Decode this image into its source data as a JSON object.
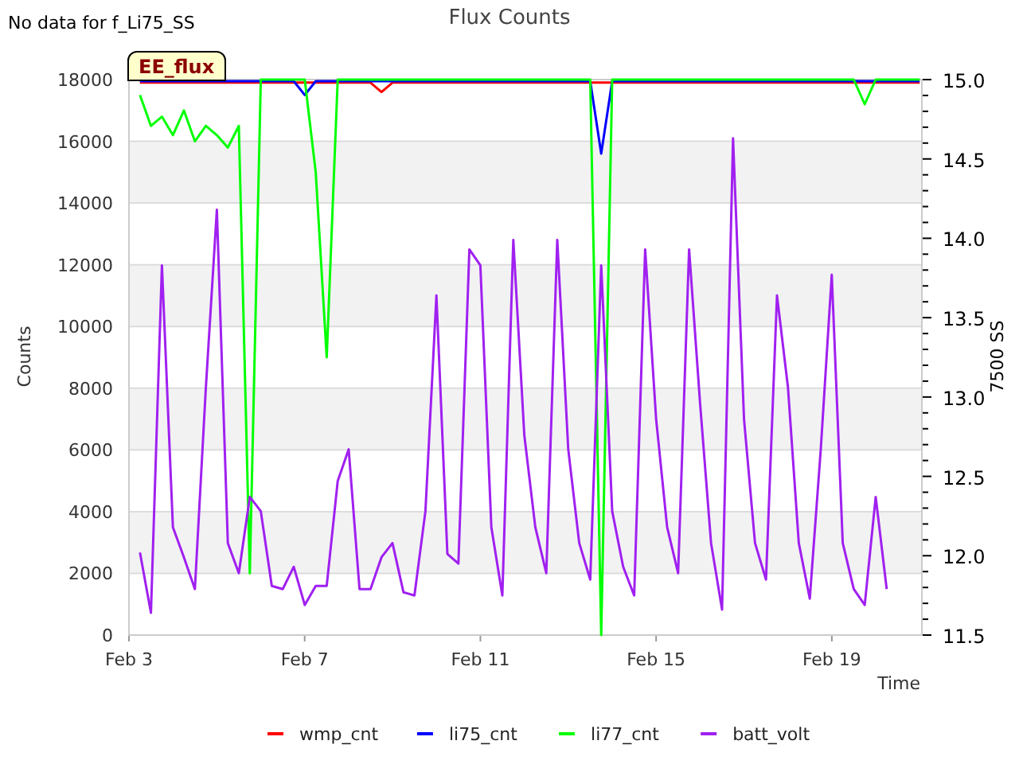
{
  "message": "No data for f_Li75_SS",
  "chart": {
    "badge": "EE_flux",
    "chart_data": {
      "type": "line",
      "title": "Flux Counts",
      "xlabel": "Time",
      "ylabel": "Counts",
      "y2label": "7500 SS",
      "ylim": [
        0,
        18000
      ],
      "grid": "y",
      "legend": "bottom",
      "y2lim": [
        11.5,
        15
      ],
      "yticks": [
        0,
        2000,
        4000,
        6000,
        8000,
        10000,
        12000,
        14000,
        16000,
        18000
      ],
      "y2ticks": [
        11.5,
        {
          "value": 12,
          "label": "12.0"
        },
        12.5,
        {
          "value": 13,
          "label": "13.0"
        },
        13.5,
        {
          "value": 14,
          "label": "14.0"
        },
        14.5,
        {
          "value": 15,
          "label": "15.0"
        }
      ],
      "categories": [
        "Feb 3",
        null,
        null,
        null,
        null,
        null,
        null,
        null,
        null,
        null,
        null,
        null,
        null,
        null,
        null,
        null,
        "Feb 7",
        null,
        null,
        null,
        null,
        null,
        null,
        null,
        null,
        null,
        null,
        null,
        null,
        null,
        null,
        null,
        "Feb 11",
        null,
        null,
        null,
        null,
        null,
        null,
        null,
        null,
        null,
        null,
        null,
        null,
        null,
        null,
        null,
        "Feb 15",
        null,
        null,
        null,
        null,
        null,
        null,
        null,
        null,
        null,
        null,
        null,
        null,
        null,
        null,
        null,
        "Feb 19",
        null,
        null,
        null,
        null,
        null,
        null,
        null,
        null
      ],
      "series": [
        {
          "name": "wmp_cnt",
          "color": "#ff0000",
          "values": [
            null,
            17900,
            17900,
            17900,
            17900,
            17900,
            17900,
            17900,
            17900,
            17900,
            17900,
            17900,
            17900,
            17900,
            17900,
            17900,
            17900,
            17900,
            17900,
            17900,
            17900,
            17900,
            17900,
            17600,
            17900,
            17900,
            17900,
            17900,
            17900,
            17900,
            17900,
            17900,
            17900,
            17900,
            17900,
            17900,
            17900,
            17900,
            17900,
            17900,
            17900,
            17900,
            17900,
            17900,
            17900,
            17900,
            17900,
            17900,
            17900,
            17900,
            17900,
            17900,
            17900,
            17900,
            17900,
            17900,
            17900,
            17900,
            17900,
            17900,
            17900,
            17900,
            17900,
            17900,
            17900,
            17900,
            17900,
            17900,
            17900,
            17900,
            17900,
            17900,
            17900
          ]
        },
        {
          "name": "li75_cnt",
          "color": "#0000ff",
          "values": [
            null,
            17950,
            17950,
            17950,
            17950,
            17950,
            17950,
            17950,
            17950,
            17950,
            17950,
            17950,
            17950,
            17950,
            17950,
            17950,
            17500,
            17950,
            17950,
            17950,
            17950,
            17950,
            17950,
            17950,
            17950,
            17950,
            17950,
            17950,
            17950,
            17950,
            17950,
            17950,
            17950,
            17950,
            17950,
            17950,
            17950,
            17950,
            17950,
            17950,
            17950,
            17950,
            17950,
            15600,
            17950,
            17950,
            17950,
            17950,
            17950,
            17950,
            17950,
            17950,
            17950,
            17950,
            17950,
            17950,
            17950,
            17950,
            17950,
            17950,
            17950,
            17950,
            17950,
            17950,
            17950,
            17950,
            17950,
            17950,
            17950,
            17950,
            17950,
            17950,
            17950
          ]
        },
        {
          "name": "li77_cnt",
          "color": "#00ff00",
          "values": [
            null,
            17500,
            16500,
            16800,
            16200,
            17000,
            16000,
            16500,
            16200,
            15800,
            16500,
            2000,
            18000,
            18000,
            18000,
            18000,
            18000,
            15000,
            9000,
            18000,
            18000,
            18000,
            18000,
            18000,
            18000,
            18000,
            18000,
            18000,
            18000,
            18000,
            18000,
            18000,
            18000,
            18000,
            18000,
            18000,
            18000,
            18000,
            18000,
            18000,
            18000,
            18000,
            18000,
            0,
            18000,
            18000,
            18000,
            18000,
            18000,
            18000,
            18000,
            18000,
            18000,
            18000,
            18000,
            18000,
            18000,
            18000,
            18000,
            18000,
            18000,
            18000,
            18000,
            18000,
            18000,
            18000,
            18000,
            17200,
            18000,
            18000,
            18000,
            18000,
            18000
          ]
        },
        {
          "name": "batt_volt",
          "color": "#a020f0",
          "axis": "y2",
          "values": [
            null,
            12.02,
            11.64,
            13.83,
            12.18,
            11.99,
            11.79,
            13.06,
            14.18,
            12.08,
            11.89,
            12.37,
            12.28,
            11.81,
            11.79,
            11.93,
            11.69,
            11.81,
            11.81,
            12.47,
            12.67,
            11.79,
            11.79,
            11.99,
            12.08,
            11.77,
            11.75,
            12.28,
            13.64,
            12.01,
            11.95,
            13.93,
            13.83,
            12.18,
            11.75,
            13.99,
            12.76,
            12.18,
            11.89,
            13.99,
            12.67,
            12.08,
            11.85,
            13.83,
            12.28,
            11.93,
            11.75,
            13.93,
            12.86,
            12.18,
            11.89,
            13.93,
            12.96,
            12.08,
            11.66,
            14.63,
            12.86,
            12.08,
            11.85,
            13.64,
            13.06,
            12.08,
            11.73,
            12.67,
            13.77,
            12.08,
            11.79,
            11.69,
            12.37,
            11.79,
            null,
            null,
            null
          ]
        }
      ]
    }
  }
}
